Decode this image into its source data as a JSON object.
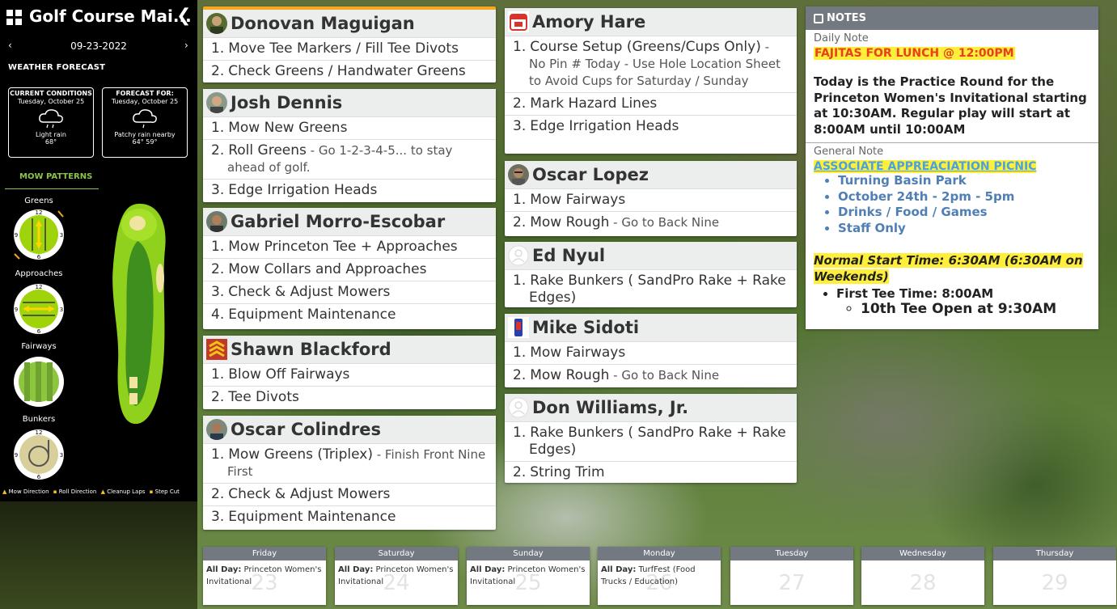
{
  "sidebar": {
    "title": "Golf Course Mai...",
    "collapse_glyph": "❮",
    "date": "09-23-2022",
    "prev_glyph": "‹",
    "next_glyph": "›",
    "weather_title": "WEATHER FORECAST",
    "current": {
      "heading": "CURRENT CONDITIONS",
      "date": "Tuesday, October 25",
      "condition": "Light rain",
      "temp": "68°"
    },
    "forecast": {
      "heading": "FORECAST FOR:",
      "date": "Tuesday, October 25",
      "condition": "Patchy rain nearby",
      "temp": "64° 59°"
    },
    "mow_patterns_title": "MOW PATTERNS",
    "patterns": [
      "Greens",
      "Approaches",
      "Fairways",
      "Bunkers"
    ],
    "legend": [
      "Mow Direction",
      "Roll Direction",
      "Cleanup Laps",
      "Step Cut"
    ]
  },
  "cards": {
    "c1": {
      "name": "Donovan Maguigan",
      "items": [
        {
          "n": "1.",
          "task": "Move Tee Markers / Fill Tee Divots",
          "detail": ""
        },
        {
          "n": "2.",
          "task": "Check Greens / Handwater Greens",
          "detail": ""
        }
      ]
    },
    "c2": {
      "name": "Josh Dennis",
      "items": [
        {
          "n": "1.",
          "task": "Mow New Greens",
          "detail": ""
        },
        {
          "n": "2.",
          "task": "Roll Greens",
          "detail": " - Go 1-2-3-4-5... to stay ahead of golf."
        },
        {
          "n": "3.",
          "task": "Edge Irrigation Heads",
          "detail": ""
        }
      ]
    },
    "c3": {
      "name": "Gabriel Morro-Escobar",
      "items": [
        {
          "n": "1.",
          "task": "Mow Princeton Tee + Approaches",
          "detail": ""
        },
        {
          "n": "2.",
          "task": "Mow Collars and Approaches",
          "detail": ""
        },
        {
          "n": "3.",
          "task": "Check & Adjust Mowers",
          "detail": ""
        },
        {
          "n": "4.",
          "task": "Equipment Maintenance",
          "detail": ""
        }
      ]
    },
    "c4": {
      "name": "Shawn Blackford",
      "items": [
        {
          "n": "1.",
          "task": "Blow Off Fairways",
          "detail": ""
        },
        {
          "n": "2.",
          "task": "Tee Divots",
          "detail": ""
        }
      ]
    },
    "c5": {
      "name": "Oscar Colindres",
      "items": [
        {
          "n": "1.",
          "task": "Mow Greens (Triplex)",
          "detail": " - Finish Front Nine First"
        },
        {
          "n": "2.",
          "task": "Check & Adjust Mowers",
          "detail": ""
        },
        {
          "n": "3.",
          "task": "Equipment Maintenance",
          "detail": ""
        }
      ]
    },
    "c6": {
      "name": "Amory Hare",
      "items": [
        {
          "n": "1.",
          "task": "Course Setup (Greens/Cups Only)",
          "detail": " - No Pin # Today - Use Hole Location Sheet to Avoid Cups for Saturday / Sunday"
        },
        {
          "n": "2.",
          "task": "Mark Hazard Lines",
          "detail": ""
        },
        {
          "n": "3.",
          "task": "Edge Irrigation Heads",
          "detail": ""
        }
      ]
    },
    "c7": {
      "name": "Oscar Lopez",
      "items": [
        {
          "n": "1.",
          "task": "Mow Fairways",
          "detail": ""
        },
        {
          "n": "2.",
          "task": "Mow Rough",
          "detail": " - Go to Back Nine"
        }
      ]
    },
    "c8": {
      "name": "Ed Nyul",
      "items": [
        {
          "n": "1.",
          "task": "Rake Bunkers ( SandPro Rake + Rake Edges)",
          "detail": ""
        }
      ]
    },
    "c9": {
      "name": "Mike Sidoti",
      "items": [
        {
          "n": "1.",
          "task": "Mow Fairways",
          "detail": ""
        },
        {
          "n": "2.",
          "task": "Mow Rough",
          "detail": " - Go to Back Nine"
        }
      ]
    },
    "c10": {
      "name": "Don Williams, Jr.",
      "items": [
        {
          "n": "1.",
          "task": "Rake Bunkers ( SandPro Rake + Rake Edges)",
          "detail": ""
        },
        {
          "n": "2.",
          "task": "String Trim",
          "detail": ""
        }
      ]
    }
  },
  "notes": {
    "title": "NOTES",
    "daily_label": "Daily Note",
    "daily_highlight": "FAJITAS FOR LUNCH @ 12:00PM",
    "daily_body": "Today is the Practice Round for the Princeton Women's Invitational starting at 10:30AM. Regular play will start at 8:00AM until 10:00AM",
    "general_label": "General Note",
    "general_link": "ASSOCIATE APPREACIATION PICNIC",
    "general_items": [
      "Turning Basin Park",
      "October 24th - 2pm - 5pm",
      "Drinks / Food / Games",
      "Staff Only"
    ],
    "start_time": "Normal Start Time: 6:30AM (6:30AM on Weekends)",
    "first_tee": "First Tee Time: 8:00AM",
    "tenth_tee": "10th Tee Open at 9:30AM"
  },
  "calendar": [
    {
      "day": "Friday",
      "num": "23",
      "event_label": "All Day:",
      "event": "Princeton Women's Invitational"
    },
    {
      "day": "Saturday",
      "num": "24",
      "event_label": "All Day:",
      "event": "Princeton Women's Invitational"
    },
    {
      "day": "Sunday",
      "num": "25",
      "event_label": "All Day:",
      "event": "Princeton Women's Invitational"
    },
    {
      "day": "Monday",
      "num": "26",
      "event_label": "All Day:",
      "event": "TurfFest (Food Trucks / Education)"
    },
    {
      "day": "Tuesday",
      "num": "27",
      "event_label": "",
      "event": ""
    },
    {
      "day": "Wednesday",
      "num": "28",
      "event_label": "",
      "event": ""
    },
    {
      "day": "Thursday",
      "num": "29",
      "event_label": "",
      "event": ""
    }
  ],
  "colors": {
    "accent_green": "#8bc34a",
    "highlight": "#ffef3a",
    "link_blue": "#4aa3df",
    "header_gray": "#737980"
  }
}
